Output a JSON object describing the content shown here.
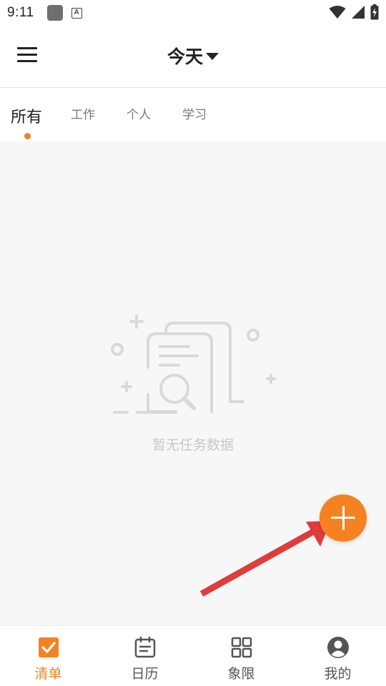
{
  "status_bar": {
    "time": "9:11",
    "icons": [
      "app-square-icon",
      "a-notification-icon",
      "wifi-icon",
      "signal-icon",
      "battery-charging-icon"
    ]
  },
  "header": {
    "title": "今天",
    "menu_icon": "hamburger-menu-icon",
    "dropdown_icon": "caret-down-icon"
  },
  "tabs": [
    {
      "label": "所有",
      "active": true
    },
    {
      "label": "工作",
      "active": false
    },
    {
      "label": "个人",
      "active": false
    },
    {
      "label": "学习",
      "active": false
    }
  ],
  "empty_state": {
    "icon": "empty-document-search-icon",
    "message": "暂无任务数据"
  },
  "fab": {
    "icon": "plus-icon"
  },
  "bottom_nav": [
    {
      "label": "清单",
      "icon": "checkbox-icon",
      "active": true
    },
    {
      "label": "日历",
      "icon": "calendar-icon",
      "active": false
    },
    {
      "label": "象限",
      "icon": "grid-icon",
      "active": false
    },
    {
      "label": "我的",
      "icon": "user-avatar-icon",
      "active": false
    }
  ],
  "colors": {
    "accent": "#f58220",
    "annotation_arrow": "#e03c3c",
    "content_bg": "#f7f7f7"
  }
}
